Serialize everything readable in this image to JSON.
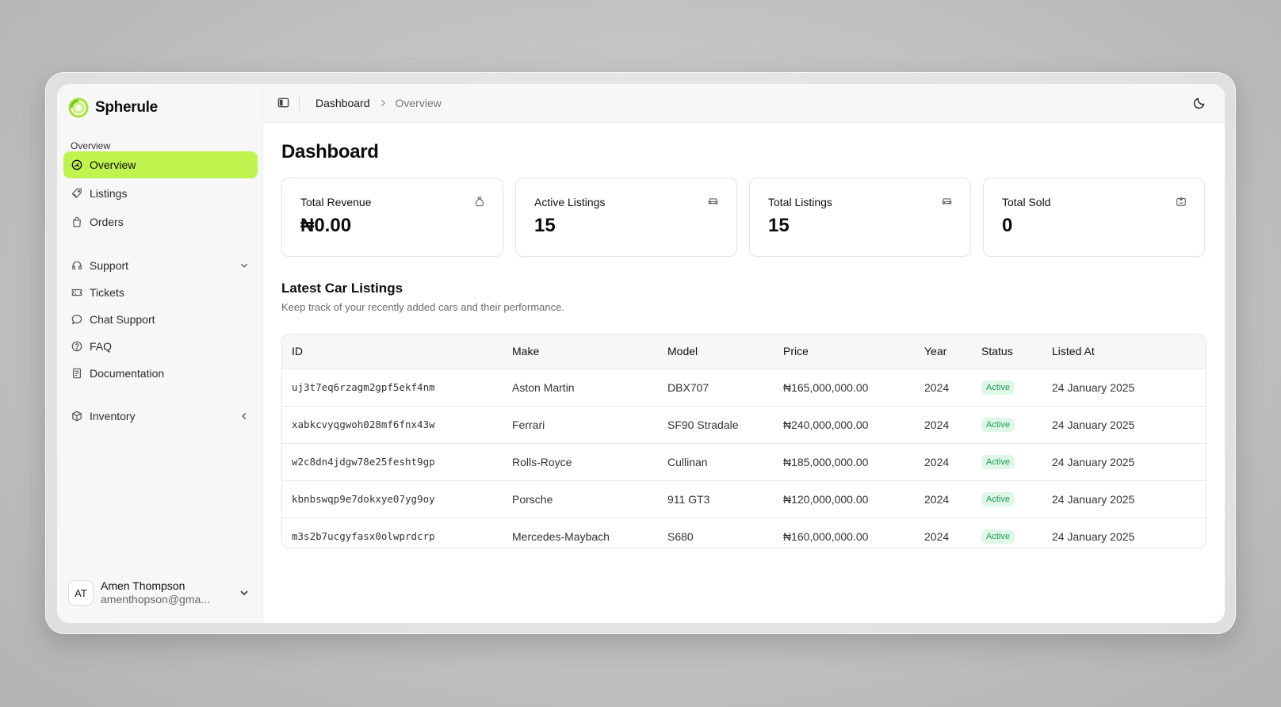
{
  "brand": {
    "name": "Spherule",
    "accent": "#bff34e"
  },
  "sidebar": {
    "group_label": "Overview",
    "primary": [
      {
        "label": "Overview",
        "icon": "gauge-icon",
        "active": true
      },
      {
        "label": "Listings",
        "icon": "tag-icon"
      },
      {
        "label": "Orders",
        "icon": "bag-icon"
      }
    ],
    "support": {
      "label": "Support",
      "icon": "headset-icon"
    },
    "support_items": [
      {
        "label": "Tickets",
        "icon": "ticket-icon"
      },
      {
        "label": "Chat Support",
        "icon": "chat-icon"
      },
      {
        "label": "FAQ",
        "icon": "help-icon"
      },
      {
        "label": "Documentation",
        "icon": "document-icon"
      }
    ],
    "inventory": {
      "label": "Inventory",
      "icon": "package-icon"
    },
    "user": {
      "initials": "AT",
      "name": "Amen Thompson",
      "email": "amenthopson@gma..."
    }
  },
  "header": {
    "breadcrumb": [
      "Dashboard",
      "Overview"
    ]
  },
  "main": {
    "title": "Dashboard",
    "cards": [
      {
        "title": "Total Revenue",
        "value": "₦0.00",
        "icon": "money-bag-icon"
      },
      {
        "title": "Active Listings",
        "value": "15",
        "icon": "car-icon"
      },
      {
        "title": "Total Listings",
        "value": "15",
        "icon": "car-icon"
      },
      {
        "title": "Total Sold",
        "value": "0",
        "icon": "sold-box-icon"
      }
    ],
    "listings": {
      "title": "Latest Car Listings",
      "subtitle": "Keep track of your recently added cars and their performance.",
      "columns": [
        "ID",
        "Make",
        "Model",
        "Price",
        "Year",
        "Status",
        "Listed At"
      ],
      "rows": [
        {
          "id": "uj3t7eq6rzagm2gpf5ekf4nm",
          "make": "Aston Martin",
          "model": "DBX707",
          "price": "₦165,000,000.00",
          "year": "2024",
          "status": "Active",
          "listed_at": "24 January 2025"
        },
        {
          "id": "xabkcvyqgwoh028mf6fnx43w",
          "make": "Ferrari",
          "model": "SF90 Stradale",
          "price": "₦240,000,000.00",
          "year": "2024",
          "status": "Active",
          "listed_at": "24 January 2025"
        },
        {
          "id": "w2c8dn4jdgw78e25fesht9gp",
          "make": "Rolls-Royce",
          "model": "Cullinan",
          "price": "₦185,000,000.00",
          "year": "2024",
          "status": "Active",
          "listed_at": "24 January 2025"
        },
        {
          "id": "kbnbswqp9e7dokxye07yg9oy",
          "make": "Porsche",
          "model": "911 GT3",
          "price": "₦120,000,000.00",
          "year": "2024",
          "status": "Active",
          "listed_at": "24 January 2025"
        },
        {
          "id": "m3s2b7ucgyfasx0olwprdcrp",
          "make": "Mercedes-Maybach",
          "model": "S680",
          "price": "₦160,000,000.00",
          "year": "2024",
          "status": "Active",
          "listed_at": "24 January 2025"
        }
      ]
    }
  }
}
